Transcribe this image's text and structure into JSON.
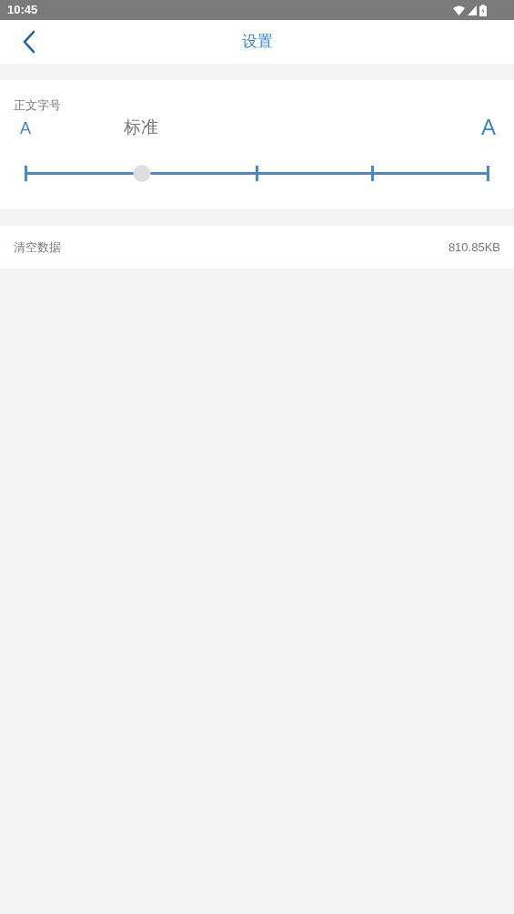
{
  "status_bar": {
    "time": "10:45"
  },
  "header": {
    "title": "设置"
  },
  "font_size": {
    "label": "正文字号",
    "min_label": "A",
    "current_label": "标准",
    "max_label": "A",
    "level": 0.25
  },
  "clear_data": {
    "label": "清空数据",
    "value": "810.85KB"
  }
}
